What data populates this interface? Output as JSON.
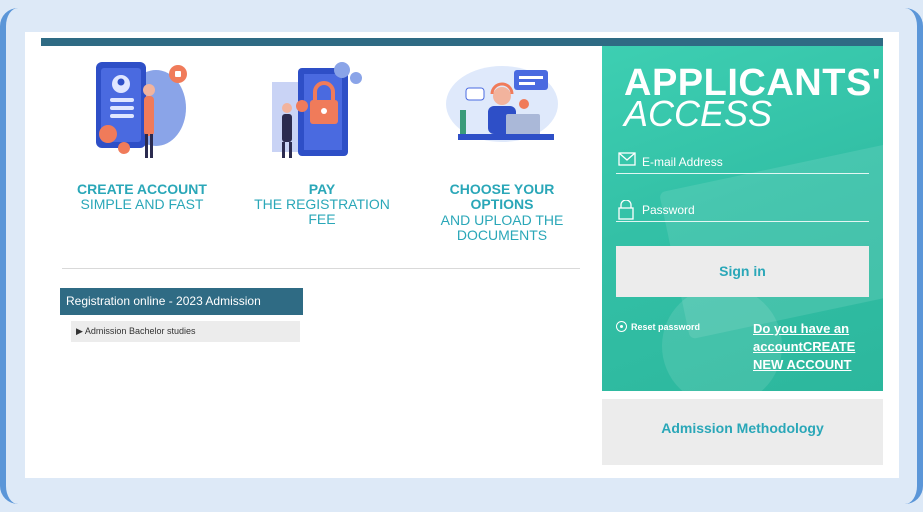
{
  "steps": [
    {
      "title": "CREATE ACCOUNT",
      "sub": "SIMPLE AND FAST"
    },
    {
      "title": "PAY",
      "sub": "THE REGISTRATION FEE"
    },
    {
      "title": "CHOOSE YOUR OPTIONS",
      "sub": "AND UPLOAD THE DOCUMENTS"
    }
  ],
  "registration": {
    "header": "Registration online - 2023 Admission",
    "item": "▶ Admission Bachelor studies"
  },
  "access": {
    "title_line1": "APPLICANTS'",
    "title_line2": "ACCESS",
    "email_placeholder": "E-mail Address",
    "password_placeholder": "Password",
    "signin_label": "Sign in",
    "reset_label": "Reset password",
    "new_account_label": "Do you have an accountCREATE NEW ACCOUNT"
  },
  "methodology_label": "Admission Methodology",
  "colors": {
    "teal_brand": "#2aa7b8",
    "panel_green": "#33c0a6",
    "header_blue": "#2f6b84",
    "frame_blue": "#5b96d8"
  }
}
